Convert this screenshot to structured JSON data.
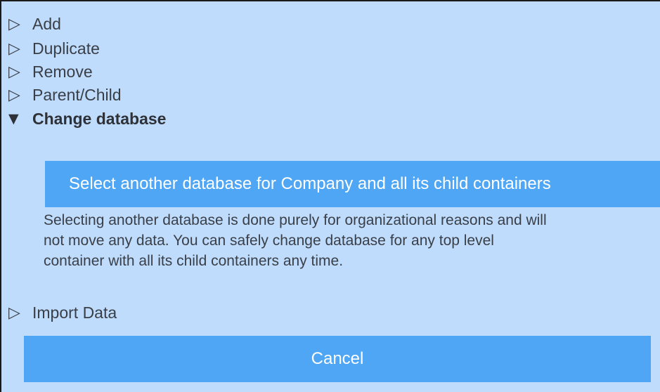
{
  "menu": {
    "items": [
      {
        "icon": "triangle-right-outline-icon",
        "label": "Add"
      },
      {
        "icon": "triangle-right-outline-icon",
        "label": "Duplicate"
      },
      {
        "icon": "triangle-right-outline-icon",
        "label": "Remove"
      },
      {
        "icon": "triangle-right-outline-icon",
        "label": "Parent/Child"
      },
      {
        "icon": "triangle-down-filled-icon",
        "label": "Change database",
        "expanded": true
      },
      {
        "icon": "triangle-right-outline-icon",
        "label": "Import Data"
      }
    ]
  },
  "change_database": {
    "button_label": "Select another database for Company and all its child containers",
    "description": "Selecting another database is done purely for organizational reasons and will\nnot move any data. You can safely change database for any top level\ncontainer with all its child containers any time."
  },
  "footer": {
    "cancel_label": "Cancel"
  },
  "colors": {
    "panel_background": "#bfdcfd",
    "button_background": "#4ea6f4",
    "button_text": "#ffffff",
    "text": "#3a3f47"
  }
}
